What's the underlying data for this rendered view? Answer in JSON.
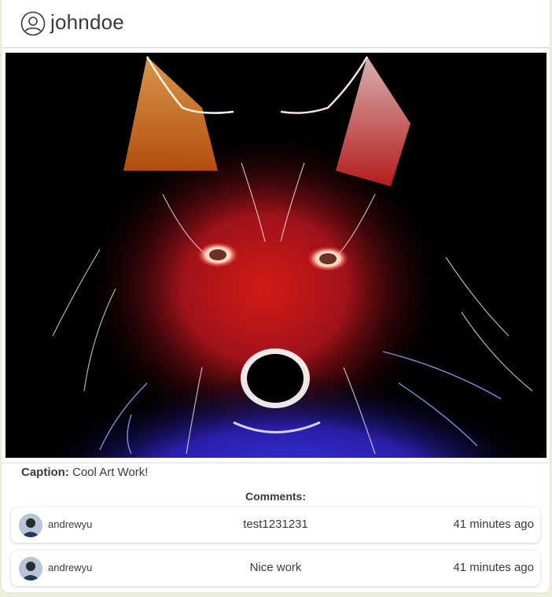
{
  "post": {
    "username": "johndoe",
    "image_alt": "Neon wolf art",
    "caption_label": "Caption:",
    "caption_text": "Cool Art Work!"
  },
  "comments_section": {
    "title": "Comments:",
    "items": [
      {
        "author": "andrewyu",
        "text": "test1231231",
        "time": "41 minutes ago"
      },
      {
        "author": "andrewyu",
        "text": "Nice work",
        "time": "41 minutes ago"
      }
    ]
  },
  "icons": {
    "user": "user-circle-icon"
  }
}
